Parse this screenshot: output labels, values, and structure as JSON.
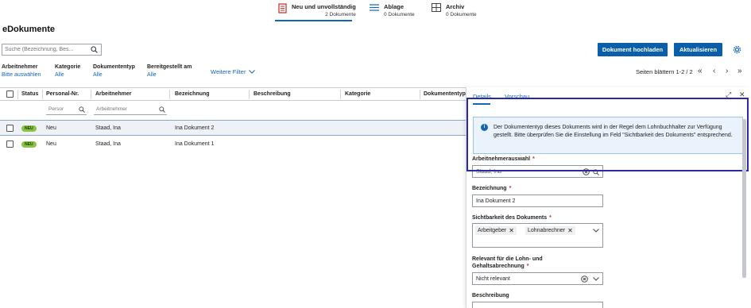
{
  "top_tabs": [
    {
      "title": "Neu und unvollständig",
      "sub": "2 Dokumente",
      "icon": "document-red-icon"
    },
    {
      "title": "Ablage",
      "sub": "0 Dokumente",
      "icon": "list-icon"
    },
    {
      "title": "Archiv",
      "sub": "0 Dokumente",
      "icon": "archive-grid-icon"
    }
  ],
  "page_title": "eDokumente",
  "search": {
    "placeholder": "Suche (Bezeichnung, Bes..."
  },
  "buttons": {
    "upload": "Dokument hochladen",
    "refresh": "Aktualisieren"
  },
  "filters": [
    {
      "label": "Arbeitnehmer",
      "value": "Bitte auswählen"
    },
    {
      "label": "Kategorie",
      "value": "Alle"
    },
    {
      "label": "Dokumententyp",
      "value": "Alle"
    },
    {
      "label": "Bereitgestellt am",
      "value": "Alle"
    }
  ],
  "more_filter": "Weitere Filter",
  "paging": {
    "text": "Seiten blättern 1-2 / 2"
  },
  "table": {
    "headers": [
      "Status",
      "Personal-Nr.",
      "Arbeitnehmer",
      "Bezeichnung",
      "Beschreibung",
      "Kategorie",
      "Dokumententyp"
    ],
    "filter_placeholders": {
      "personal": "Persor",
      "arbeitnehmer": "Arbeitnehmer"
    },
    "rows": [
      {
        "badge": "NEU",
        "status": "Neu",
        "arbeitnehmer": "Staad, Ina",
        "bezeichnung": "Ina Dokument 2"
      },
      {
        "badge": "NEU",
        "status": "Neu",
        "arbeitnehmer": "Staad, Ina",
        "bezeichnung": "Ina Dokument 1"
      }
    ]
  },
  "panel": {
    "tabs": [
      "Details",
      "Vorschau"
    ],
    "info": "Der Dokumententyp dieses Dokuments wird in der Regel dem Lohnbuchhalter zur Verfügung gestellt. Bitte überprüfen Sie die Einstellung im Feld \"Sichtbarkeit des Dokuments\" entsprechend.",
    "fields": {
      "arbeitnehmer_label": "Arbeitnehmerauswahl",
      "arbeitnehmer_value": "Staad, Ina",
      "bezeichnung_label": "Bezeichnung",
      "bezeichnung_value": "Ina Dokument 2",
      "sichtbarkeit_label": "Sichtbarkeit des Dokuments",
      "sichtbarkeit_chips": [
        "Arbeitgeber",
        "Lohnabrechner"
      ],
      "relevant_label_1": "Relevant für die Lohn- und",
      "relevant_label_2": "Gehaltsabrechnung",
      "relevant_value": "Nicht relevant",
      "beschreibung_label": "Beschreibung"
    },
    "required_mark": "*"
  },
  "colors": {
    "primary": "#0b5fa9",
    "link": "#1565b5",
    "badge": "#8bc34a",
    "highlight": "#2a2aa8"
  }
}
